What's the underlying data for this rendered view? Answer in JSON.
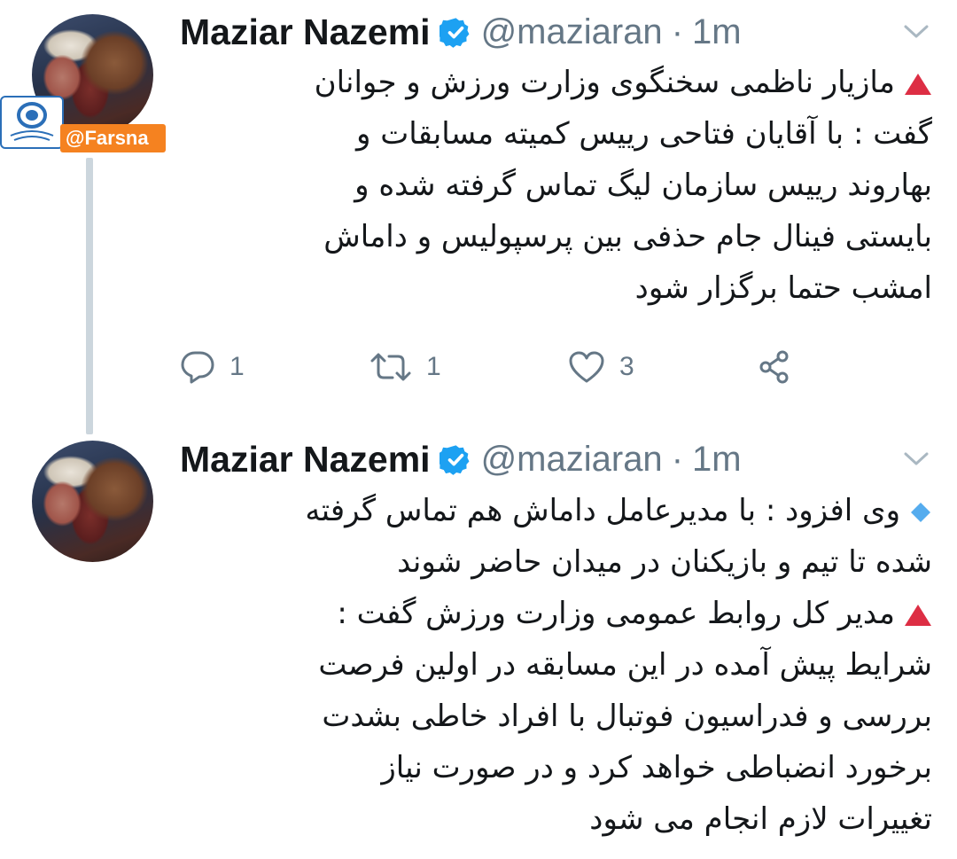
{
  "thread": {
    "tweets": [
      {
        "author_name": "Maziar Nazemi",
        "handle": "@maziaran",
        "separator": "·",
        "time": "1m",
        "badge_text": "@Farsna",
        "badge_logo_text": "خبرگزاری فارس",
        "lines": [
          {
            "marker": "red-triangle",
            "text": "مازیار ناظمی سخنگوی وزارت ورزش و جوانان"
          },
          {
            "marker": "",
            "text": "گفت : با آقایان فتاحی رییس کمیته مسابقات و"
          },
          {
            "marker": "",
            "text": "بهاروند رییس سازمان لیگ تماس گرفته شده و"
          },
          {
            "marker": "",
            "text": "بایستی فینال جام حذفی بین پرسپولیس و داماش"
          },
          {
            "marker": "",
            "text": "امشب حتما برگزار شود"
          }
        ],
        "reply_count": "1",
        "retweet_count": "1",
        "like_count": "3"
      },
      {
        "author_name": "Maziar Nazemi",
        "handle": "@maziaran",
        "separator": "·",
        "time": "1m",
        "lines": [
          {
            "marker": "blue-diamond",
            "text": "وی افزود : با مدیرعامل داماش هم تماس گرفته"
          },
          {
            "marker": "",
            "text": "شده تا تیم و بازیکنان در میدان حاضر شوند"
          },
          {
            "marker": "red-triangle",
            "text": "مدیر کل روابط عمومی وزارت ورزش گفت :"
          },
          {
            "marker": "",
            "text": "شرایط پیش آمده در این مسابقه در اولین فرصت"
          },
          {
            "marker": "",
            "text": "بررسی و فدراسیون فوتبال با افراد خاطی بشدت"
          },
          {
            "marker": "",
            "text": "برخورد انضباطی خواهد کرد و در صورت نیاز"
          },
          {
            "marker": "",
            "text": "تغییرات لازم انجام می شود"
          }
        ]
      }
    ]
  },
  "colors": {
    "verified": "#1da1f2",
    "meta_gray": "#657786",
    "thread_line": "#ccd6dd",
    "red_triangle": "#dd2e44",
    "blue_diamond": "#55acee",
    "farsna_orange": "#f58220"
  },
  "icons": {
    "verified": "verified-badge-icon",
    "caret": "chevron-down-icon",
    "reply": "reply-icon",
    "retweet": "retweet-icon",
    "like": "heart-icon",
    "share": "share-icon"
  }
}
